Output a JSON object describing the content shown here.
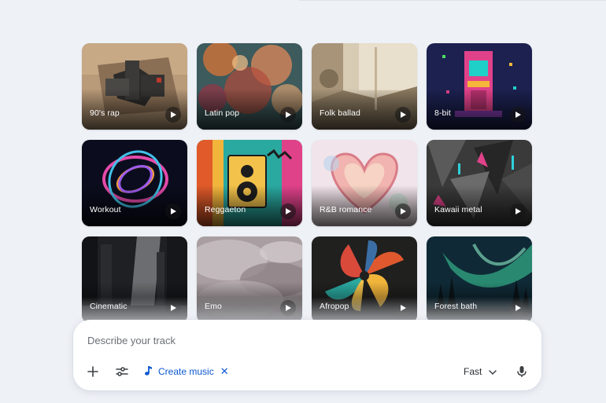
{
  "styles": [
    {
      "label": "90's rap",
      "icon": "play-icon"
    },
    {
      "label": "Latin pop",
      "icon": "play-icon"
    },
    {
      "label": "Folk ballad",
      "icon": "play-icon"
    },
    {
      "label": "8-bit",
      "icon": "play-icon"
    },
    {
      "label": "Workout",
      "icon": "play-icon"
    },
    {
      "label": "Reggaeton",
      "icon": "play-icon"
    },
    {
      "label": "R&B romance",
      "icon": "play-icon"
    },
    {
      "label": "Kawaii metal",
      "icon": "play-icon"
    },
    {
      "label": "Cinematic",
      "icon": "play-icon"
    },
    {
      "label": "Emo",
      "icon": "play-icon"
    },
    {
      "label": "Afropop",
      "icon": "play-icon"
    },
    {
      "label": "Forest bath",
      "icon": "play-icon"
    }
  ],
  "composer": {
    "placeholder": "Describe your track",
    "add_icon": "plus-icon",
    "tools_icon": "sliders-icon",
    "mode_chip": {
      "label": "Create music",
      "icon": "music-note-icon",
      "remove": "✕"
    },
    "speed": {
      "label": "Fast",
      "icon": "chevron-down-icon"
    },
    "mic_icon": "mic-icon"
  },
  "colors": {
    "accent": "#0b57d0",
    "background": "#eef1f6"
  }
}
